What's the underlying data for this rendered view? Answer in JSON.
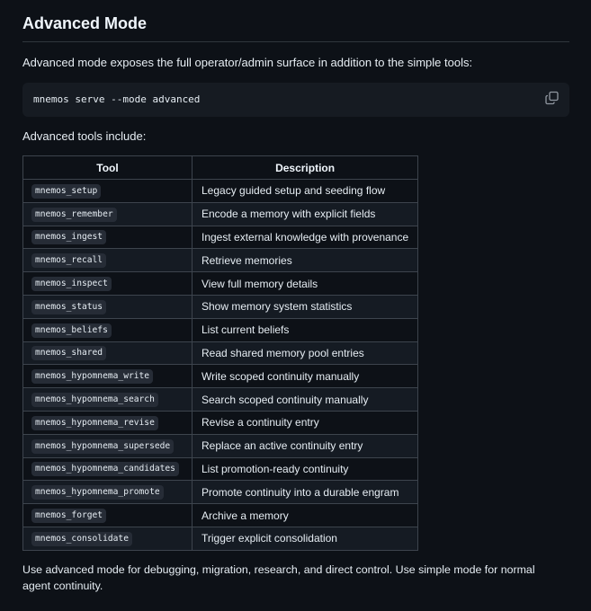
{
  "heading": "Advanced Mode",
  "intro": "Advanced mode exposes the full operator/admin surface in addition to the simple tools:",
  "command": "mnemos serve --mode advanced",
  "tools_intro": "Advanced tools include:",
  "table": {
    "headers": [
      "Tool",
      "Description"
    ],
    "rows": [
      {
        "tool": "mnemos_setup",
        "description": "Legacy guided setup and seeding flow"
      },
      {
        "tool": "mnemos_remember",
        "description": "Encode a memory with explicit fields"
      },
      {
        "tool": "mnemos_ingest",
        "description": "Ingest external knowledge with provenance"
      },
      {
        "tool": "mnemos_recall",
        "description": "Retrieve memories"
      },
      {
        "tool": "mnemos_inspect",
        "description": "View full memory details"
      },
      {
        "tool": "mnemos_status",
        "description": "Show memory system statistics"
      },
      {
        "tool": "mnemos_beliefs",
        "description": "List current beliefs"
      },
      {
        "tool": "mnemos_shared",
        "description": "Read shared memory pool entries"
      },
      {
        "tool": "mnemos_hypomnema_write",
        "description": "Write scoped continuity manually"
      },
      {
        "tool": "mnemos_hypomnema_search",
        "description": "Search scoped continuity manually"
      },
      {
        "tool": "mnemos_hypomnema_revise",
        "description": "Revise a continuity entry"
      },
      {
        "tool": "mnemos_hypomnema_supersede",
        "description": "Replace an active continuity entry"
      },
      {
        "tool": "mnemos_hypomnema_candidates",
        "description": "List promotion-ready continuity"
      },
      {
        "tool": "mnemos_hypomnema_promote",
        "description": "Promote continuity into a durable engram"
      },
      {
        "tool": "mnemos_forget",
        "description": "Archive a memory"
      },
      {
        "tool": "mnemos_consolidate",
        "description": "Trigger explicit consolidation"
      }
    ]
  },
  "outro": "Use advanced mode for debugging, migration, research, and direct control. Use simple mode for normal agent continuity.",
  "icons": {
    "copy": "copy-icon"
  },
  "colors": {
    "background": "#0d1117",
    "code_background": "#161b22",
    "border": "#3d444d",
    "text": "#e6edf3"
  }
}
